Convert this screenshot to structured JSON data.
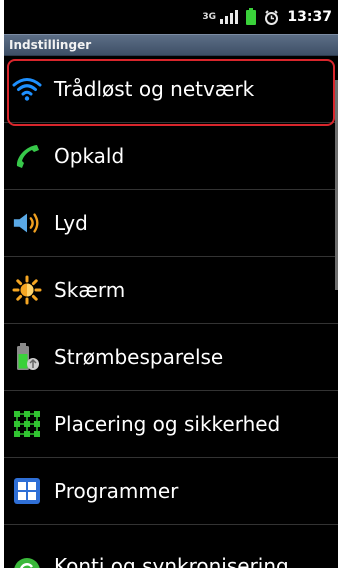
{
  "status": {
    "network_type": "3G",
    "time": "13:37"
  },
  "header": {
    "title": "Indstillinger"
  },
  "settings": {
    "items": [
      {
        "label": "Trådløst og netværk",
        "icon": "wifi-icon"
      },
      {
        "label": "Opkald",
        "icon": "phone-icon"
      },
      {
        "label": "Lyd",
        "icon": "speaker-icon"
      },
      {
        "label": "Skærm",
        "icon": "brightness-icon"
      },
      {
        "label": "Strømbesparelse",
        "icon": "battery-saver-icon"
      },
      {
        "label": "Placering og sikkerhed",
        "icon": "location-security-icon"
      },
      {
        "label": "Programmer",
        "icon": "applications-icon"
      },
      {
        "label": "Konti og synkronisering",
        "icon": "sync-icon"
      }
    ]
  },
  "colors": {
    "highlight": "#d9262c",
    "wifi": "#1e90ff",
    "phone": "#37c84a",
    "title_bar": "#4a5b72"
  }
}
